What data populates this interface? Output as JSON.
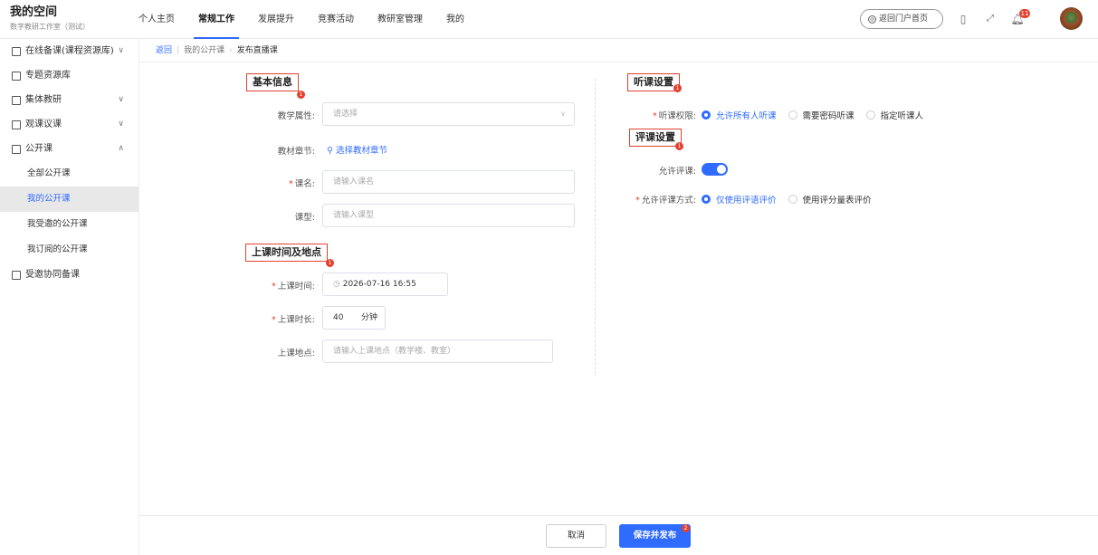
{
  "header": {
    "title": "我的空间",
    "subtitle": "数字教研工作室（测试）",
    "nav": [
      {
        "label": "个人主页",
        "active": false
      },
      {
        "label": "常规工作",
        "active": true
      },
      {
        "label": "发展提升",
        "active": false
      },
      {
        "label": "竞赛活动",
        "active": false
      },
      {
        "label": "教研室管理",
        "active": false
      },
      {
        "label": "我的",
        "active": false
      }
    ],
    "portal_button": "返回门户首页",
    "notification_count": "11",
    "accent_color": "#2f6bff"
  },
  "sidebar": {
    "items": [
      {
        "label": "在线备课(课程资源库)",
        "icon": "book-icon",
        "chevron": "down"
      },
      {
        "label": "专题资源库",
        "icon": "box-icon"
      },
      {
        "label": "集体教研",
        "icon": "doc-icon",
        "chevron": "down"
      },
      {
        "label": "观课议课",
        "icon": "presentation-icon",
        "chevron": "down"
      },
      {
        "label": "公开课",
        "icon": "screen-icon",
        "chevron": "up"
      }
    ],
    "subitems": [
      {
        "label": "全部公开课",
        "active": false
      },
      {
        "label": "我的公开课",
        "active": true
      },
      {
        "label": "我受邀的公开课",
        "active": false
      },
      {
        "label": "我订阅的公开课",
        "active": false
      }
    ],
    "last_item": {
      "label": "受邀协同备课",
      "icon": "group-icon"
    }
  },
  "breadcrumb": {
    "back": "返回",
    "parent": "我的公开课",
    "current": "发布直播课"
  },
  "basic_info": {
    "title": "基本信息",
    "badge": "1",
    "attribute_label": "教学属性:",
    "attribute_placeholder": "请选择",
    "chapter_label": "教材章节:",
    "chapter_link": "选择教材章节",
    "name_label": "课名:",
    "name_placeholder": "请输入课名",
    "type_label": "课型:",
    "type_placeholder": "请输入课型"
  },
  "time_place": {
    "title": "上课时间及地点",
    "badge": "1",
    "time_label": "上课时间:",
    "time_value": "2026-07-16 16:55",
    "duration_label": "上课时长:",
    "duration_value": "40",
    "duration_unit": "分钟",
    "place_label": "上课地点:",
    "place_placeholder": "请输入上课地点（教学楼、教室）"
  },
  "listen_settings": {
    "title": "听课设置",
    "badge": "1",
    "permission_label": "听课权限:",
    "options": [
      {
        "label": "允许所有人听课",
        "selected": true
      },
      {
        "label": "需要密码听课",
        "selected": false
      },
      {
        "label": "指定听课人",
        "selected": false
      }
    ]
  },
  "review_settings": {
    "title": "评课设置",
    "badge": "1",
    "allow_label": "允许评课:",
    "allow_on": true,
    "method_label": "允许评课方式:",
    "options": [
      {
        "label": "仅使用评语评价",
        "selected": true
      },
      {
        "label": "使用评分量表评价",
        "selected": false
      }
    ]
  },
  "footer": {
    "cancel": "取消",
    "save": "保存并发布",
    "save_badge": "2"
  }
}
